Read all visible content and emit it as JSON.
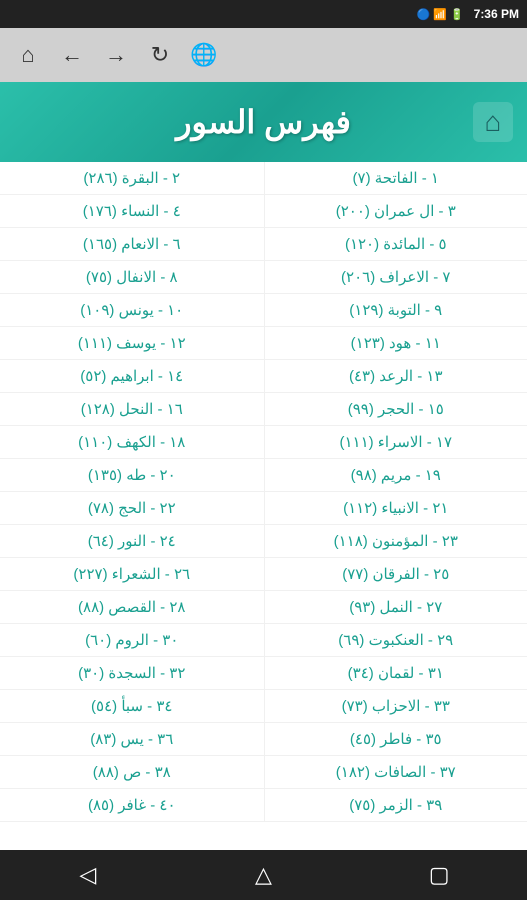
{
  "statusBar": {
    "time": "7:36 PM",
    "icons": "🔵📶🔋"
  },
  "navBar": {
    "home": "⌂",
    "back": "←",
    "forward": "→",
    "refresh": "↻",
    "globe": "🌐"
  },
  "header": {
    "title": "فهرس السور",
    "homeIcon": "⌂"
  },
  "surahs": [
    {
      "right": "١ - الفاتحة (٧)",
      "left": "٢ - البقرة (٢٨٦)"
    },
    {
      "right": "٣ - ال عمران (٢٠٠)",
      "left": "٤ - النساء (١٧٦)"
    },
    {
      "right": "٥ - المائدة (١٢٠)",
      "left": "٦ - الانعام (١٦٥)"
    },
    {
      "right": "٧ - الاعراف (٢٠٦)",
      "left": "٨ - الانفال (٧٥)"
    },
    {
      "right": "٩ - التوبة (١٢٩)",
      "left": "١٠ - يونس (١٠٩)"
    },
    {
      "right": "١١ - هود (١٢٣)",
      "left": "١٢ - يوسف (١١١)"
    },
    {
      "right": "١٣ - الرعد (٤٣)",
      "left": "١٤ - ابراهيم (٥٢)"
    },
    {
      "right": "١٥ - الحجر (٩٩)",
      "left": "١٦ - النحل (١٢٨)"
    },
    {
      "right": "١٧ - الاسراء (١١١)",
      "left": "١٨ - الكهف (١١٠)"
    },
    {
      "right": "١٩ - مريم (٩٨)",
      "left": "٢٠ - طه (١٣٥)"
    },
    {
      "right": "٢١ - الانبياء (١١٢)",
      "left": "٢٢ - الحج (٧٨)"
    },
    {
      "right": "٢٣ - المؤمنون (١١٨)",
      "left": "٢٤ - النور (٦٤)"
    },
    {
      "right": "٢٥ - الفرقان (٧٧)",
      "left": "٢٦ - الشعراء (٢٢٧)"
    },
    {
      "right": "٢٧ - النمل (٩٣)",
      "left": "٢٨ - القصص (٨٨)"
    },
    {
      "right": "٢٩ - العنكبوت (٦٩)",
      "left": "٣٠ - الروم (٦٠)"
    },
    {
      "right": "٣١ - لقمان (٣٤)",
      "left": "٣٢ - السجدة (٣٠)"
    },
    {
      "right": "٣٣ - الاحزاب (٧٣)",
      "left": "٣٤ - سبأ (٥٤)"
    },
    {
      "right": "٣٥ - فاطر (٤٥)",
      "left": "٣٦ - يس (٨٣)"
    },
    {
      "right": "٣٧ - الصافات (١٨٢)",
      "left": "٣٨ - ص (٨٨)"
    },
    {
      "right": "٣٩ - الزمر (٧٥)",
      "left": "٤٠ - غافر (٨٥)"
    }
  ],
  "bottomNav": {
    "back": "◁",
    "home": "△",
    "recent": "▢"
  }
}
